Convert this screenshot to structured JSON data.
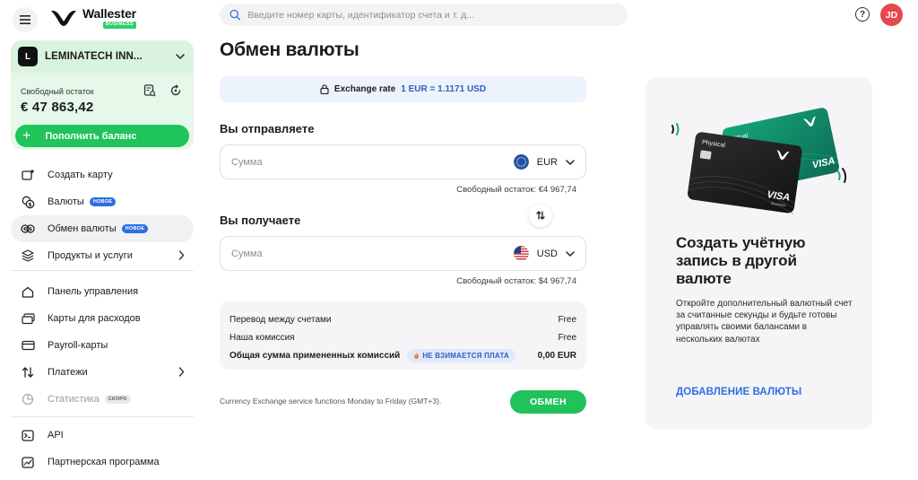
{
  "header": {
    "logo_name": "Wallester",
    "logo_badge": "BUSINESS",
    "search_placeholder": "Введите номер карты, идентификатор счета и т. д...",
    "help_glyph": "?",
    "avatar_initials": "JD",
    "avatar_color": "#e5484d"
  },
  "account": {
    "logo_letter": "L",
    "name": "LEMINATECH INN...",
    "balance_label": "Свободный остаток",
    "balance_amount": "€ 47 863,42",
    "topup_label": "Пополнить баланс"
  },
  "nav": {
    "group1": [
      {
        "label": "Создать карту",
        "icon": "card-plus-icon"
      },
      {
        "label": "Валюты",
        "icon": "currencies-icon",
        "tag": "НОВОЕ"
      },
      {
        "label": "Обмен валюты",
        "icon": "exchange-icon",
        "tag": "НОВОЕ",
        "active": true
      },
      {
        "label": "Продукты и услуги",
        "icon": "products-icon"
      }
    ],
    "group2": [
      {
        "label": "Панель управления",
        "icon": "home-icon"
      },
      {
        "label": "Карты для расходов",
        "icon": "cards-icon"
      },
      {
        "label": "Payroll-карты",
        "icon": "payroll-card-icon"
      },
      {
        "label": "Платежи",
        "icon": "payments-icon"
      },
      {
        "label": "Статистика",
        "icon": "statistics-icon",
        "tag": "СКОРО"
      }
    ],
    "group3": [
      {
        "label": "API",
        "icon": "api-icon"
      },
      {
        "label": "Партнерская программа",
        "icon": "partner-icon"
      }
    ]
  },
  "main": {
    "title": "Обмен валюты",
    "rate_label": "Exchange rate",
    "rate_value": "1 EUR = 1.1171 USD",
    "send": {
      "title": "Вы отправляете",
      "placeholder": "Сумма",
      "currency": "EUR",
      "available": "Свободный остаток: €4 967,74"
    },
    "receive": {
      "title": "Вы получаете",
      "placeholder": "Сумма",
      "currency": "USD",
      "available": "Свободный остаток: $4 967,74"
    },
    "fees": {
      "transfer_label": "Перевод между счетами",
      "transfer_value": "Free",
      "commission_label": "Наша комиссия",
      "commission_value": "Free",
      "total_label": "Общая сумма примененных комиссий",
      "total_badge": "НЕ ВЗИМАЕТСЯ ПЛАТА",
      "total_value": "0,00 EUR"
    },
    "footer_note": "Currency Exchange service functions Monday to Friday (GMT+3).",
    "exchange_button": "ОБМЕН"
  },
  "promo": {
    "card_virtual_label": "Virtual",
    "card_physical_label": "Physical",
    "card_brand": "VISA",
    "card_sub": "Business",
    "title": "Создать учётную запись в другой валюте",
    "text": "Откройте дополнительный валютный счет за считанные секунды и будьте готовы управлять своими балансами в нескольких валютах",
    "link": "ДОБАВЛЕНИЕ ВАЛЮТЫ"
  },
  "colors": {
    "accent_green": "#22c25a",
    "accent_blue": "#2f6ee0",
    "account_bg": "#e6f8e9"
  }
}
